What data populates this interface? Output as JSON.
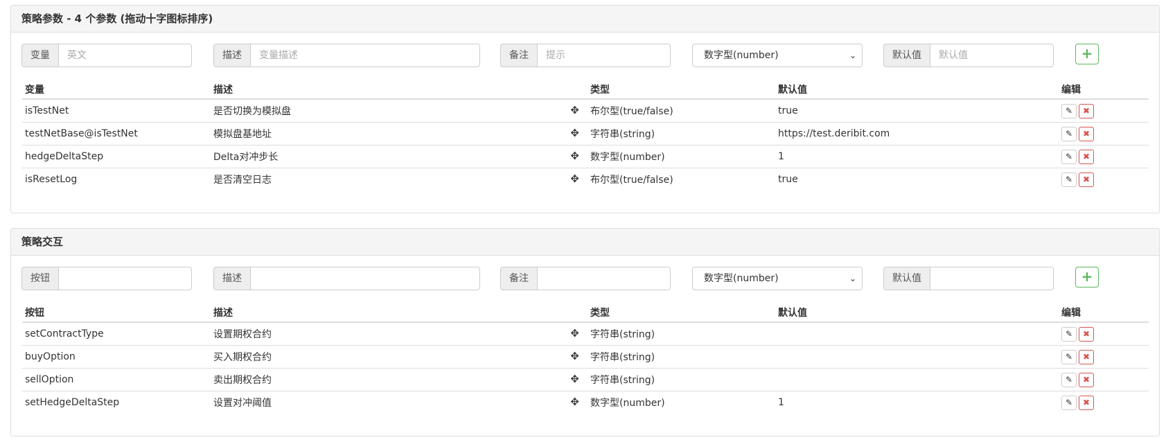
{
  "panels": [
    {
      "title": "策略参数 - 4 个参数 (拖动十字图标排序)",
      "form": {
        "name_label": "变量",
        "name_placeholder": "英文",
        "desc_label": "描述",
        "desc_placeholder": "变量描述",
        "note_label": "备注",
        "note_placeholder": "提示",
        "type_selected": "数字型(number)",
        "default_label": "默认值",
        "default_placeholder": "默认值",
        "add_icon": "plus-icon"
      },
      "columns": [
        "变量",
        "描述",
        "类型",
        "默认值",
        "编辑"
      ],
      "rows": [
        {
          "name": "isTestNet",
          "desc": "是否切换为模拟盘",
          "type": "布尔型(true/false)",
          "default": "true"
        },
        {
          "name": "testNetBase@isTestNet",
          "desc": "模拟盘基地址",
          "type": "字符串(string)",
          "default": "https://test.deribit.com"
        },
        {
          "name": "hedgeDeltaStep",
          "desc": "Delta对冲步长",
          "type": "数字型(number)",
          "default": "1"
        },
        {
          "name": "isResetLog",
          "desc": "是否清空日志",
          "type": "布尔型(true/false)",
          "default": "true"
        }
      ]
    },
    {
      "title": "策略交互",
      "form": {
        "name_label": "按钮",
        "name_placeholder": "",
        "desc_label": "描述",
        "desc_placeholder": "",
        "note_label": "备注",
        "note_placeholder": "",
        "type_selected": "数字型(number)",
        "default_label": "默认值",
        "default_placeholder": "",
        "add_icon": "plus-icon"
      },
      "columns": [
        "按钮",
        "描述",
        "类型",
        "默认值",
        "编辑"
      ],
      "rows": [
        {
          "name": "setContractType",
          "desc": "设置期权合约",
          "type": "字符串(string)",
          "default": ""
        },
        {
          "name": "buyOption",
          "desc": "买入期权合约",
          "type": "字符串(string)",
          "default": ""
        },
        {
          "name": "sellOption",
          "desc": "卖出期权合约",
          "type": "字符串(string)",
          "default": ""
        },
        {
          "name": "setHedgeDeltaStep",
          "desc": "设置对冲阈值",
          "type": "数字型(number)",
          "default": "1"
        }
      ]
    }
  ],
  "icons": {
    "move": "move-icon",
    "edit": "pencil-icon",
    "delete": "close-icon"
  },
  "colors": {
    "add": "#5cb85c",
    "delete": "#d9534f",
    "heading_bg": "#f5f5f5"
  }
}
